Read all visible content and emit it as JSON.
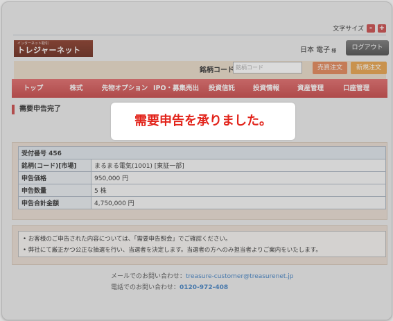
{
  "header": {
    "font_size_label": "文字サイズ",
    "font_minus": "-",
    "font_plus": "+",
    "logo_small": "インターネット取引",
    "logo_main": "トレジャーネット",
    "user_name": "日本 電子",
    "honorific": "様",
    "logout_label": "ログアウト"
  },
  "order_bar": {
    "code_label": "銘柄コード",
    "code_placeholder": "銘柄コード",
    "sell_button": "売買注文",
    "new_button": "新規注文"
  },
  "nav": {
    "items": [
      "トップ",
      "株式",
      "先物オプション",
      "IPO・募集売出",
      "投資信託",
      "投資情報",
      "資産管理",
      "口座管理"
    ]
  },
  "page": {
    "section_title": "需要申告完了",
    "toast_message": "需要申告を承りました。"
  },
  "detail": {
    "receipt": "受付番号 456",
    "rows": [
      {
        "label": "銘柄(コード)[市場]",
        "value": "まるまる電気(1001) [東証一部]"
      },
      {
        "label": "申告価格",
        "value": "950,000 円"
      },
      {
        "label": "申告数量",
        "value": "5 株"
      },
      {
        "label": "申告合計金額",
        "value": "4,750,000 円"
      }
    ]
  },
  "notes": [
    "お客様のご申告された内容については、「需要申告照会」でご確認ください。",
    "弊社にて厳正かつ公正な抽選を行い、当選者を決定します。当選者の方へのみ担当者よりご案内をいたします。"
  ],
  "contact": {
    "mail_label": "メールでのお問い合わせ：",
    "mail_address": "treasure-customer@treasurenet.jp",
    "phone_label": "電話でのお問い合わせ：",
    "phone_number": "0120-972-408"
  },
  "colors": {
    "nav": "#d45555",
    "accent_red": "#e2231a",
    "sell_button": "#e38657",
    "new_button": "#e8a24a",
    "link": "#3f7fc2"
  }
}
